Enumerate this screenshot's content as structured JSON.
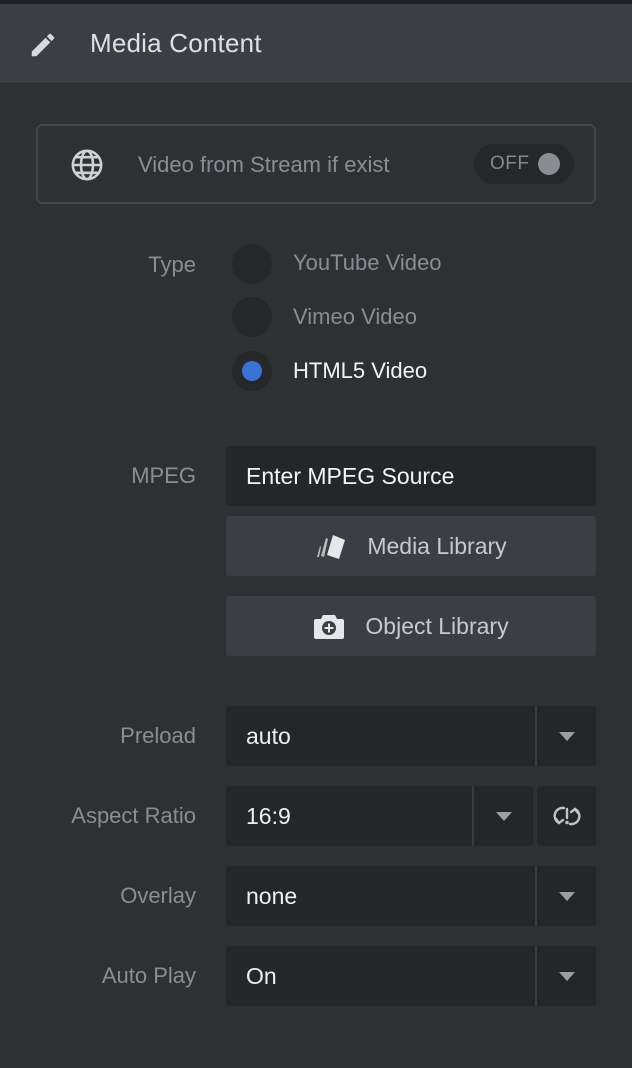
{
  "header": {
    "title": "Media Content",
    "icon": "pencil-icon"
  },
  "stream": {
    "label": "Video from Stream if exist",
    "toggle_text": "OFF",
    "icon": "globe-icon"
  },
  "type": {
    "label": "Type",
    "options": [
      "YouTube Video",
      "Vimeo Video",
      "HTML5 Video"
    ],
    "selected": "HTML5 Video"
  },
  "mpeg": {
    "label": "MPEG",
    "value": "Enter MPEG Source"
  },
  "buttons": {
    "media_library": "Media Library",
    "object_library": "Object Library"
  },
  "preload": {
    "label": "Preload",
    "value": "auto"
  },
  "aspect": {
    "label": "Aspect Ratio",
    "value": "16:9",
    "reset_icon": "reset-ratio-icon"
  },
  "overlay": {
    "label": "Overlay",
    "value": "none"
  },
  "autoplay": {
    "label": "Auto Play",
    "value": "On"
  },
  "colors": {
    "accent": "#3b73d4",
    "panel": "#2f3034",
    "header": "#3c3e43",
    "field": "#25262a"
  }
}
